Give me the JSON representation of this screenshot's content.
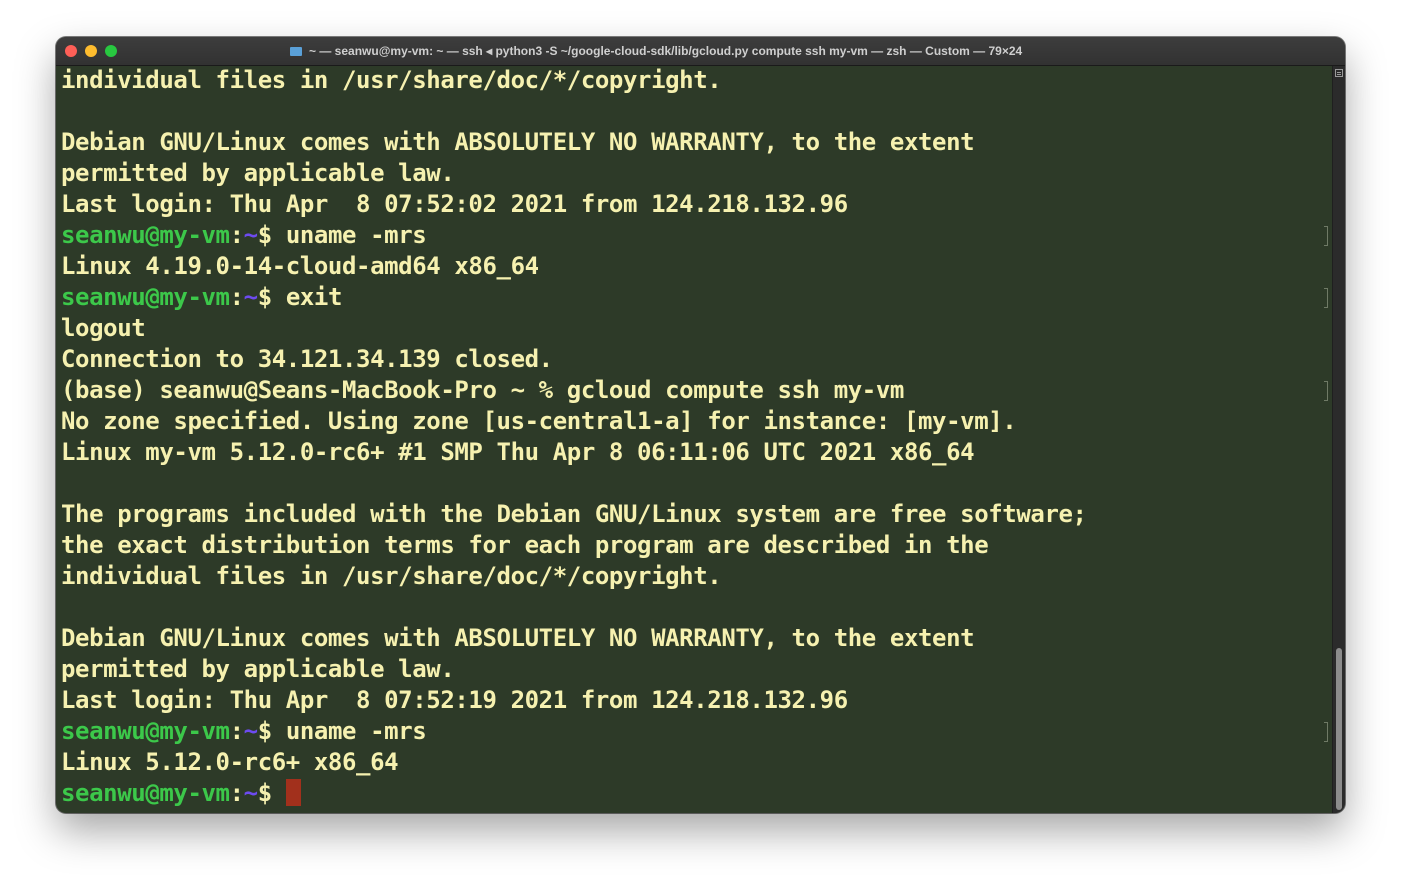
{
  "window": {
    "title": "~ — seanwu@my-vm: ~ — ssh ◂ python3 -S ~/google-cloud-sdk/lib/gcloud.py compute ssh my-vm — zsh — Custom — 79×24",
    "folder_icon": "folder-icon",
    "colors": {
      "background": "#2d3a28",
      "text": "#f6f1b0",
      "user": "#3cc84a",
      "path": "#6d4bf0",
      "cursor": "#a2301c"
    }
  },
  "terminal": {
    "lines": {
      "l0": "individual files in /usr/share/doc/*/copyright.",
      "l1": "",
      "l2": "Debian GNU/Linux comes with ABSOLUTELY NO WARRANTY, to the extent",
      "l3": "permitted by applicable law.",
      "l4": "Last login: Thu Apr  8 07:52:02 2021 from 124.218.132.96",
      "l5_user": "seanwu@my-vm",
      "l5_colon": ":",
      "l5_path": "~",
      "l5_cmd": "$ uname -mrs",
      "l6": "Linux 4.19.0-14-cloud-amd64 x86_64",
      "l7_user": "seanwu@my-vm",
      "l7_colon": ":",
      "l7_path": "~",
      "l7_cmd": "$ exit",
      "l8": "logout",
      "l9": "Connection to 34.121.34.139 closed.",
      "l10": "(base) seanwu@Seans-MacBook-Pro ~ % gcloud compute ssh my-vm",
      "l11": "No zone specified. Using zone [us-central1-a] for instance: [my-vm].",
      "l12": "Linux my-vm 5.12.0-rc6+ #1 SMP Thu Apr 8 06:11:06 UTC 2021 x86_64",
      "l13": "",
      "l14": "The programs included with the Debian GNU/Linux system are free software;",
      "l15": "the exact distribution terms for each program are described in the",
      "l16": "individual files in /usr/share/doc/*/copyright.",
      "l17": "",
      "l18": "Debian GNU/Linux comes with ABSOLUTELY NO WARRANTY, to the extent",
      "l19": "permitted by applicable law.",
      "l20": "Last login: Thu Apr  8 07:52:19 2021 from 124.218.132.96",
      "l21_user": "seanwu@my-vm",
      "l21_colon": ":",
      "l21_path": "~",
      "l21_cmd": "$ uname -mrs",
      "l22": "Linux 5.12.0-rc6+ x86_64",
      "l23_user": "seanwu@my-vm",
      "l23_colon": ":",
      "l23_path": "~",
      "l23_cmd": "$ "
    }
  }
}
